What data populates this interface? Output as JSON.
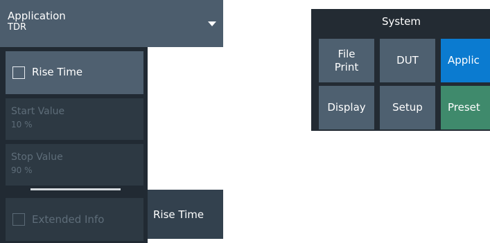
{
  "left_panel": {
    "header": {
      "title": "Application",
      "subtitle": "TDR"
    },
    "softkeys": {
      "rise_time": {
        "label": "Rise Time",
        "checked": false
      },
      "start_value": {
        "label": "Start Value",
        "value": "10 %"
      },
      "stop_value": {
        "label": "Stop Value",
        "value": "90 %"
      },
      "extended_info": {
        "label": "Extended Info",
        "checked": false
      }
    },
    "side_tab": {
      "label": "Rise Time"
    }
  },
  "system_panel": {
    "title": "System",
    "buttons": [
      {
        "label": "File\nPrint",
        "label_line1": "File",
        "label_line2": "Print"
      },
      {
        "label": "DUT"
      },
      {
        "label": "Applic"
      },
      {
        "label": "Display"
      },
      {
        "label": "Setup"
      },
      {
        "label": "Preset"
      }
    ],
    "colors": {
      "default": "#4e6070",
      "active": "#0b7bd0",
      "preset": "#3f8a6c",
      "background": "#232b33"
    }
  }
}
